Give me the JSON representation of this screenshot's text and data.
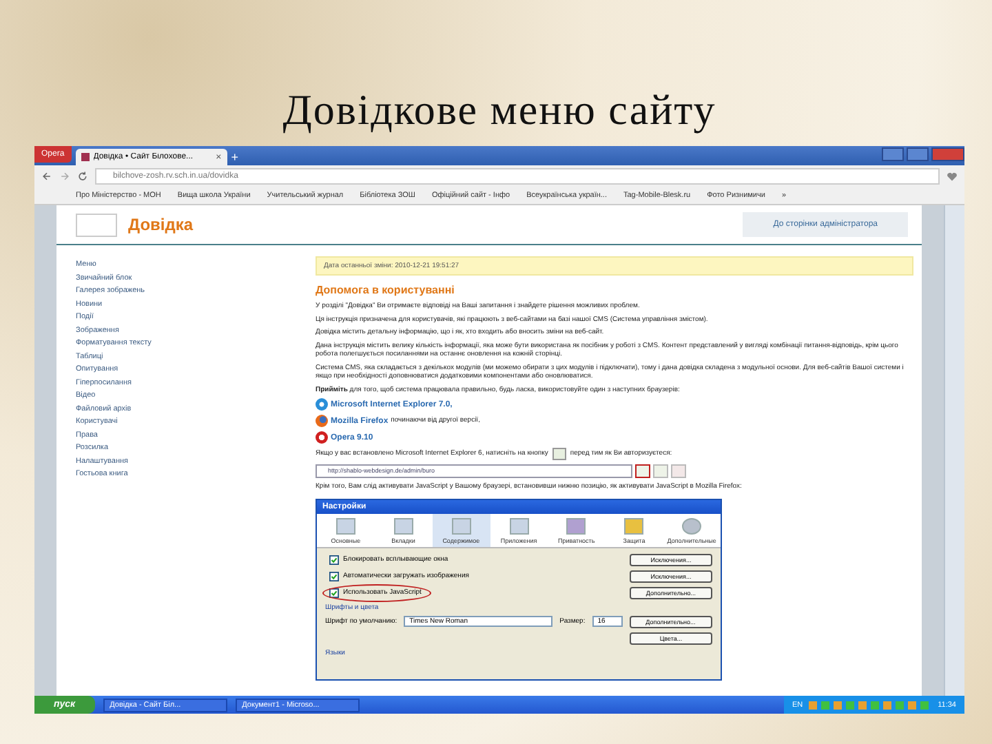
{
  "slide": {
    "title": "Довідкове меню сайту"
  },
  "browser": {
    "menu_button": "Opera",
    "tab": {
      "title": "Довідка • Сайт Білохове...",
      "close": "×"
    },
    "new_tab": "+",
    "address": "bilchove-zosh.rv.sch.in.ua/dovidka",
    "bookmarks": [
      {
        "label": "Про Міністерство - МОН"
      },
      {
        "label": "Вища школа України"
      },
      {
        "label": "Учительський журнал"
      },
      {
        "label": "Бібліотека ЗОШ"
      },
      {
        "label": "Офіційний сайт - Інфо"
      },
      {
        "label": "Всеукраїнська україн..."
      },
      {
        "label": "Tag-Mobile-Blesk.ru"
      },
      {
        "label": "Фото Ризнимичи"
      }
    ],
    "more": "»"
  },
  "page": {
    "heading": "Довідка",
    "admin_button": "До сторінки адміністратора",
    "sidebar": [
      "Меню",
      "Звичайний блок",
      "Галерея зображень",
      "Новини",
      "Події",
      "Зображення",
      "Форматування тексту",
      "Таблиці",
      "Опитування",
      "Гіперпосилання",
      "Відео",
      "Файловий архів",
      "Користувачі",
      "Права",
      "Розсилка",
      "Налаштування",
      "Гостьова книга"
    ],
    "date_note": "Дата останньої зміни: 2010-12-21 19:51:27",
    "section_title": "Допомога в користуванні",
    "paragraphs": [
      "У розділі \"Довідка\" Ви отримаєте відповіді на Ваші запитання і знайдете рішення можливих проблем.",
      "Ця інструкція призначена для користувачів, які працюють з веб-сайтами на базі нашої CMS (Система управління змістом).",
      "Довідка містить детальну інформацію, що і як, хто входить або вносить зміни на веб-сайт.",
      "Дана інструкція містить велику кількість інформації, яка може бути використана як посібник у роботі з CMS. Контент представлений у вигляді комбінації питання-відповідь, крім цього робота полегшується посиланнями на останнє оновлення на кожній сторінці.",
      "Система CMS, яка складається з декількох модулів (ми можемо обирати з цих модулів і підключати), тому і дана довідка складена з модульної основи. Для веб-сайтів Вашої системи і якщо при необхідності доповнюватися додатковими компонентами або оновлюватися.",
      "**Прийміть** для того, щоб система працювала правильно, будь ласка, використовуйте один з наступних браузерів:"
    ],
    "browsers": [
      {
        "kind": "ie",
        "name": "Microsoft Internet Explorer 7.0,"
      },
      {
        "kind": "firefox",
        "name": "Mozilla Firefox",
        "note": " починаючи від другої версії,"
      },
      {
        "kind": "opera",
        "name": "Opera 9.10"
      }
    ],
    "ie6_note": {
      "before": "Якщо у вас встановлено Microsoft Internet Explorer 6, натисніть на кнопку",
      "after": "перед тим як Ви авторизуєтеся:"
    },
    "address_example": "http://shablo-webdesign.de/admin/buro",
    "js_note": "Крім того, Вам слід активувати JavaScript у Вашому браузері, встановивши нижню позицію, як активувати JavaScript в Mozilla Firefox:"
  },
  "dialog": {
    "title": "Настройки",
    "tabs": [
      {
        "label": "Основные",
        "kind": "general",
        "selected": false
      },
      {
        "label": "Вкладки",
        "kind": "tabs",
        "selected": false
      },
      {
        "label": "Содержимое",
        "kind": "content",
        "selected": true
      },
      {
        "label": "Приложения",
        "kind": "apps",
        "selected": false
      },
      {
        "label": "Приватность",
        "kind": "privacy",
        "selected": false
      },
      {
        "label": "Защита",
        "kind": "security",
        "selected": false
      },
      {
        "label": "Дополнительные",
        "kind": "advanced",
        "selected": false
      }
    ],
    "checkboxes": [
      {
        "label": "Блокировать всплывающие окна",
        "checked": true,
        "circled": false,
        "button": "Исключения..."
      },
      {
        "label": "Автоматически загружать изображения",
        "checked": true,
        "circled": false,
        "button": "Исключения..."
      },
      {
        "label": "Использовать JavaScript",
        "checked": true,
        "circled": true,
        "button": "Дополнительно..."
      }
    ],
    "fonts": {
      "title": "Шрифты и цвета",
      "font_label": "Шрифт по умолчанию:",
      "font_value": "Times New Roman",
      "size_label": "Размер:",
      "size_value": "16",
      "buttons": [
        "Дополнительно...",
        "Цвета..."
      ]
    },
    "languages_title": "Языки"
  },
  "taskbar": {
    "start": "пуск",
    "tasks": [
      "Довідка - Сайт Біл...",
      "Документ1 - Microso..."
    ],
    "lang": "EN",
    "clock": "11:34"
  }
}
